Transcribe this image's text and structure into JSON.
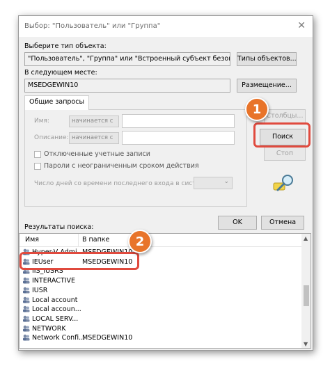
{
  "window": {
    "title": "Выбор: \"Пользователь\" или \"Группа\"",
    "close": "✕"
  },
  "object_type": {
    "label": "Выберите тип объекта:",
    "value": "\"Пользователь\", \"Группа\" или \"Встроенный субъект безопасности\"",
    "button": "Типы объектов..."
  },
  "location": {
    "label": "В следующем месте:",
    "value": "MSEDGEWIN10",
    "button": "Размещение..."
  },
  "tab": {
    "label": "Общие запросы",
    "name_label": "Имя:",
    "name_combo": "начинается с",
    "desc_label": "Описание:",
    "desc_combo": "начинается с",
    "disabled_accounts": "Отключенные учетные записи",
    "nonexpiring_passwords": "Пароли с неограниченным сроком действия",
    "days_label": "Число дней со времени последнего входа в систему:"
  },
  "side_buttons": {
    "columns": "Столбцы...",
    "search": "Поиск",
    "stop": "Стоп"
  },
  "actions": {
    "ok": "OK",
    "cancel": "Отмена"
  },
  "results": {
    "label": "Результаты поиска:",
    "columns": [
      "Имя",
      "В папке"
    ],
    "rows": [
      {
        "name": "Hyper-V Admi...",
        "folder": "MSEDGEWIN10"
      },
      {
        "name": "IEUser",
        "folder": "MSEDGEWIN10"
      },
      {
        "name": "IIS_IUSRS",
        "folder": ""
      },
      {
        "name": "INTERACTIVE",
        "folder": ""
      },
      {
        "name": "IUSR",
        "folder": ""
      },
      {
        "name": "Local account",
        "folder": ""
      },
      {
        "name": "Local accoun...",
        "folder": ""
      },
      {
        "name": "LOCAL SERV...",
        "folder": ""
      },
      {
        "name": "NETWORK",
        "folder": ""
      },
      {
        "name": "Network Confi...",
        "folder": "MSEDGEWIN10"
      }
    ]
  },
  "callouts": {
    "one": "1",
    "two": "2"
  },
  "colors": {
    "callout": "#e04a3e",
    "badge": "#e8742a"
  }
}
